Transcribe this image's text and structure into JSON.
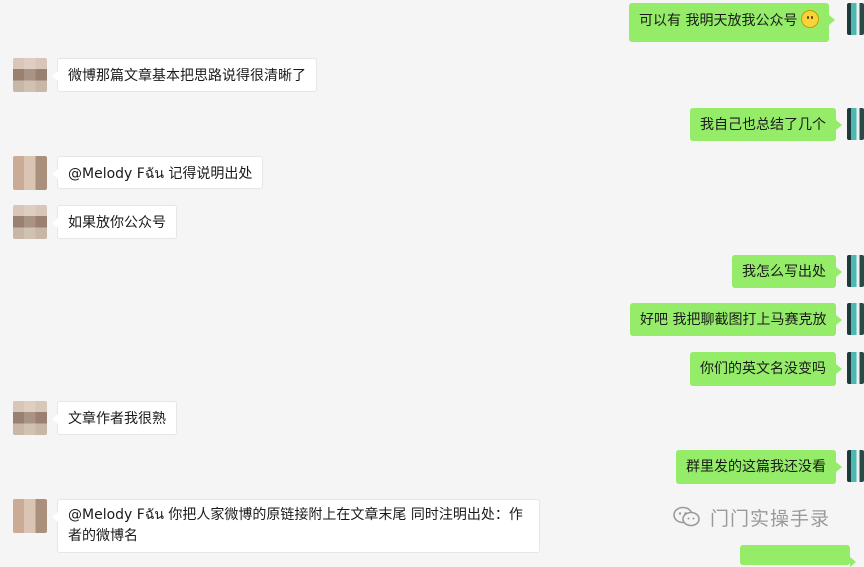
{
  "messages": [
    {
      "side": "right",
      "text": "可以有 我明天放我公众号",
      "emoji": "smile-emoji"
    },
    {
      "side": "left",
      "text": "微博那篇文章基本把思路说得很清晰了"
    },
    {
      "side": "right",
      "text": "我自己也总结了几个"
    },
    {
      "side": "left",
      "text": "@Melody Fฉัน 记得说明出处"
    },
    {
      "side": "left",
      "text": "如果放你公众号"
    },
    {
      "side": "right",
      "text": "我怎么写出处"
    },
    {
      "side": "right",
      "text": "好吧 我把聊截图打上马赛克放"
    },
    {
      "side": "right",
      "text": "你们的英文名没变吗"
    },
    {
      "side": "left",
      "text": "文章作者我很熟"
    },
    {
      "side": "right",
      "text": "群里发的这篇我还没看"
    },
    {
      "side": "left",
      "text": "@Melody Fฉัน 你把人家微博的原链接附上在文章末尾 同时注明出处：作者的微博名"
    }
  ],
  "watermark": {
    "text": "门门实操手录",
    "icon": "wechat-official-account-icon"
  },
  "colors": {
    "background": "#f5f5f5",
    "incoming_bubble": "#ffffff",
    "outgoing_bubble": "#95ec69"
  }
}
